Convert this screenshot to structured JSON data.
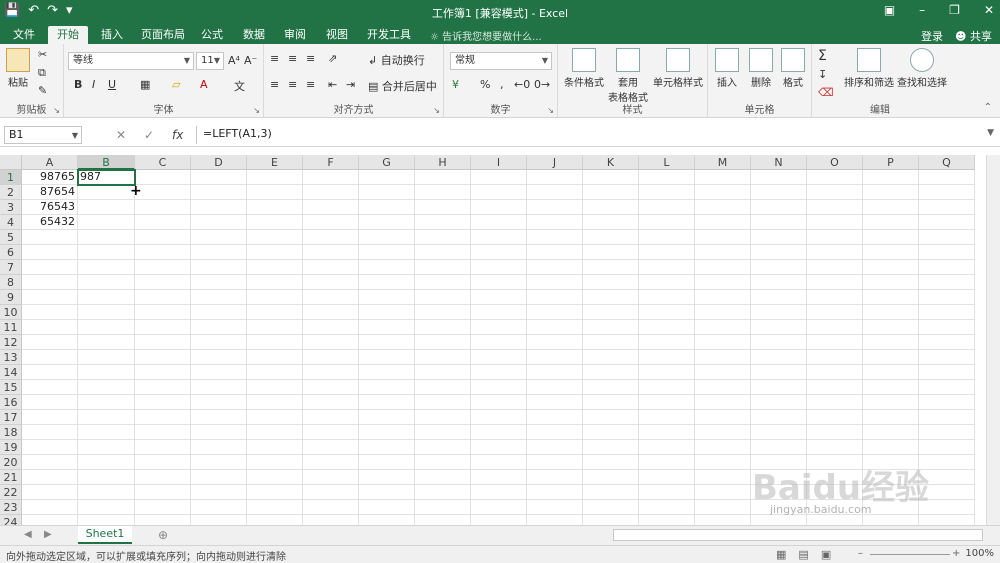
{
  "window": {
    "title": "工作簿1  [兼容模式] - Excel",
    "qat_icons": [
      "save-icon",
      "undo-icon",
      "redo-icon",
      "customize-icon"
    ]
  },
  "tabs": [
    "文件",
    "开始",
    "插入",
    "页面布局",
    "公式",
    "数据",
    "审阅",
    "视图",
    "开发工具"
  ],
  "active_tab": "开始",
  "tell_me": "告诉我您想要做什么...",
  "account": {
    "login": "登录",
    "share": "共享"
  },
  "ribbon": {
    "clipboard": {
      "label": "剪贴板",
      "paste": "粘贴"
    },
    "font": {
      "label": "字体",
      "font_name": "等线",
      "font_size": "11"
    },
    "alignment": {
      "label": "对齐方式",
      "wrap": "自动换行",
      "merge": "合并后居中"
    },
    "number": {
      "label": "数字",
      "format": "常规"
    },
    "styles": {
      "label": "样式",
      "conditional": "条件格式",
      "table_1": "套用",
      "table_2": "表格格式",
      "cell_styles": "单元格样式"
    },
    "cells": {
      "label": "单元格",
      "insert": "插入",
      "delete": "删除",
      "format": "格式"
    },
    "editing": {
      "label": "编辑",
      "sort": "排序和筛选",
      "find": "查找和选择"
    }
  },
  "formula_bar": {
    "name_box": "B1",
    "formula": "=LEFT(A1,3)",
    "fx": "fx"
  },
  "columns": [
    "A",
    "B",
    "C",
    "D",
    "E",
    "F",
    "G",
    "H",
    "I",
    "J",
    "K",
    "L",
    "M",
    "N",
    "O",
    "P",
    "Q"
  ],
  "rows": [
    "1",
    "2",
    "3",
    "4",
    "5",
    "6",
    "7",
    "8",
    "9",
    "10",
    "11",
    "12",
    "13",
    "14",
    "15",
    "16",
    "17",
    "18",
    "19",
    "20",
    "21",
    "22",
    "23",
    "24"
  ],
  "cells": {
    "A1": "98765",
    "A2": "87654",
    "A3": "76543",
    "A4": "65432",
    "B1": "987"
  },
  "selected_cell": "B1",
  "sheets": [
    "Sheet1"
  ],
  "status": {
    "message": "向外拖动选定区域，可以扩展或填充序列；向内拖动则进行清除",
    "zoom": "100%"
  },
  "watermark": {
    "main": "Baidu经验",
    "sub": "jingyan.baidu.com"
  }
}
